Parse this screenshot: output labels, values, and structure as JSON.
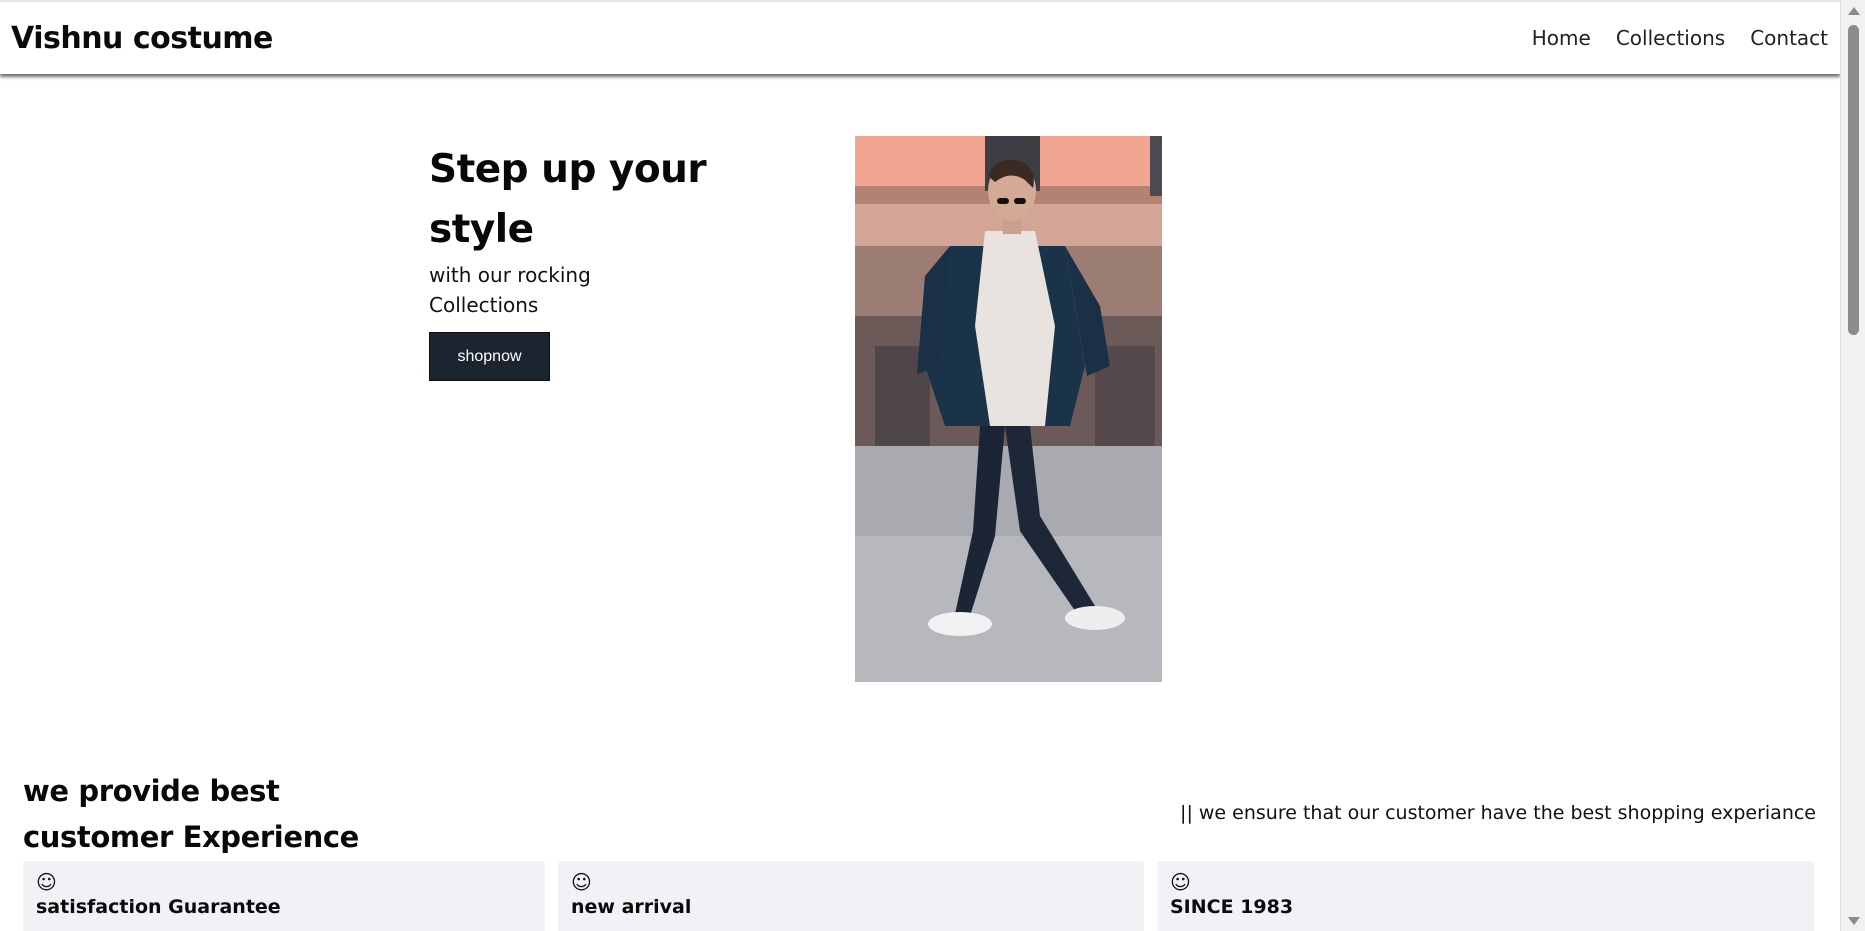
{
  "header": {
    "brand": "Vishnu costume",
    "nav": [
      "Home",
      "Collections",
      "Contact"
    ]
  },
  "hero": {
    "title": "Step up your style",
    "subtitle": "with our rocking Collections",
    "button": "shopnow",
    "image_icon": "fashion-model-photo"
  },
  "experience": {
    "title": "we provide best customer Experience",
    "note": "|| we ensure that our customer have the best shopping experiance",
    "cards": [
      {
        "icon": "smiley-icon",
        "title": "satisfaction Guarantee"
      },
      {
        "icon": "smiley-icon",
        "title": "new arrival"
      },
      {
        "icon": "smiley-icon",
        "title": "SINCE 1983"
      }
    ]
  },
  "colors": {
    "button_bg": "#1c2430",
    "card_bg": "#f1f2f6",
    "text": "#080808"
  }
}
